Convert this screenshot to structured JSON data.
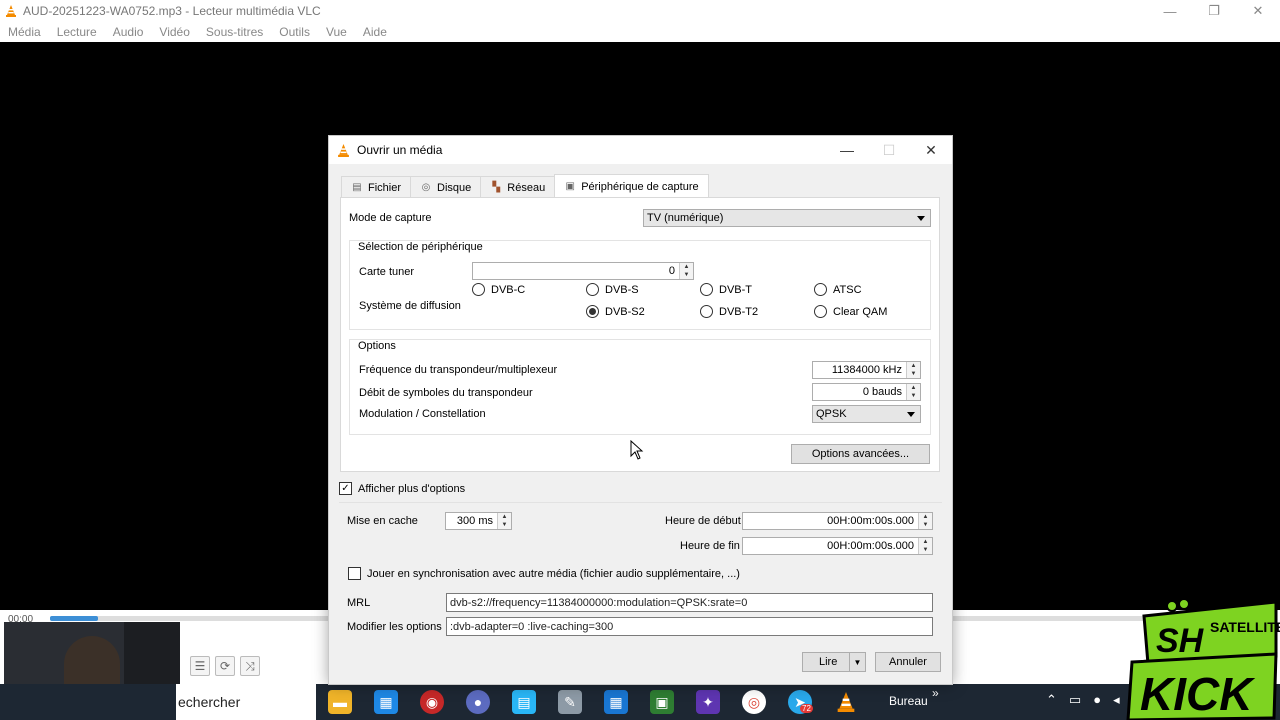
{
  "window": {
    "title": "AUD-20251223-WA0752.mp3 - Lecteur multimédia VLC",
    "controls": {
      "minimize": "—",
      "maximize": "❐",
      "close": "✕"
    }
  },
  "menu": [
    "Média",
    "Lecture",
    "Audio",
    "Vidéo",
    "Sous-titres",
    "Outils",
    "Vue",
    "Aide"
  ],
  "player": {
    "time": "00:00",
    "progress_fraction": 0.04
  },
  "dialog": {
    "title": "Ouvrir un média",
    "tabs": [
      {
        "label": "Fichier",
        "icon": "file-icon"
      },
      {
        "label": "Disque",
        "icon": "disc-icon"
      },
      {
        "label": "Réseau",
        "icon": "network-icon"
      },
      {
        "label": "Périphérique de capture",
        "icon": "capture-icon",
        "active": true
      }
    ],
    "capture_mode": {
      "label": "Mode de capture",
      "value": "TV (numérique)"
    },
    "device_selection": {
      "title": "Sélection de périphérique",
      "tuner_label": "Carte tuner",
      "tuner_value": "0",
      "system_label": "Système de diffusion",
      "systems": [
        {
          "label": "DVB-C",
          "checked": false
        },
        {
          "label": "DVB-S",
          "checked": false
        },
        {
          "label": "DVB-T",
          "checked": false
        },
        {
          "label": "ATSC",
          "checked": false
        },
        {
          "label": "DVB-S2",
          "checked": true
        },
        {
          "label": "DVB-T2",
          "checked": false
        },
        {
          "label": "Clear QAM",
          "checked": false
        }
      ]
    },
    "options": {
      "title": "Options",
      "frequency_label": "Fréquence du transpondeur/multiplexeur",
      "frequency_value": "11384000 kHz",
      "symbol_rate_label": "Débit de symboles du transpondeur",
      "symbol_rate_value": "0 bauds",
      "modulation_label": "Modulation / Constellation",
      "modulation_value": "QPSK"
    },
    "advanced_button": "Options avancées...",
    "show_more": {
      "label": "Afficher plus d'options",
      "checked": true
    },
    "cache": {
      "label": "Mise en cache",
      "value": "300 ms"
    },
    "start_time": {
      "label": "Heure de début",
      "value": "00H:00m:00s.000"
    },
    "end_time": {
      "label": "Heure de fin",
      "value": "00H:00m:00s.000"
    },
    "sync": {
      "label": "Jouer en synchronisation avec autre média (fichier audio supplémentaire, ...)",
      "checked": false
    },
    "mrl": {
      "label": "MRL",
      "value": "dvb-s2://frequency=11384000000:modulation=QPSK:srate=0"
    },
    "edit_options": {
      "label": "Modifier les options",
      "value": ":dvb-adapter=0 :live-caching=300"
    },
    "play_button": "Lire",
    "cancel_button": "Annuler"
  },
  "taskbar": {
    "search_text": "echercher",
    "desktop_label": "Bureau",
    "telegram_badge": "72",
    "chevron": "»"
  },
  "overlay_logo": {
    "top_text": "SH SATELLITE",
    "bottom_text": "KICK"
  },
  "colors": {
    "accent": "#3d8fd6",
    "taskbar": "#1d2733",
    "vlc_orange": "#f48b00",
    "logo_green": "#7ed321"
  }
}
